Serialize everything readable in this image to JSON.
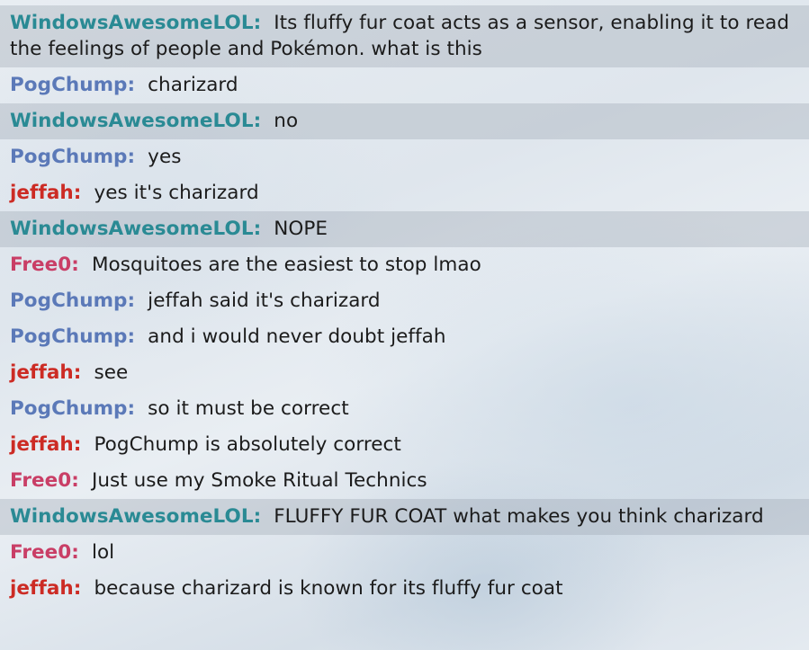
{
  "colors": {
    "WindowsAwesomeLOL": "#2a8a94",
    "PogChump": "#5b79b8",
    "jeffah": "#cc2b24",
    "Free0": "#c93e66"
  },
  "messages": [
    {
      "user": "WindowsAwesomeLOL",
      "text": "Its fluffy fur coat acts as a sensor, enabling it to read the feelings of people and Pokémon. what is this",
      "highlighted": true
    },
    {
      "user": "PogChump",
      "text": "charizard",
      "highlighted": false
    },
    {
      "user": "WindowsAwesomeLOL",
      "text": "no",
      "highlighted": true
    },
    {
      "user": "PogChump",
      "text": "yes",
      "highlighted": false
    },
    {
      "user": "jeffah",
      "text": "yes it's charizard",
      "highlighted": false
    },
    {
      "user": "WindowsAwesomeLOL",
      "text": "NOPE",
      "highlighted": true
    },
    {
      "user": "Free0",
      "text": "Mosquitoes are the easiest to stop lmao",
      "highlighted": false
    },
    {
      "user": "PogChump",
      "text": "jeffah said it's charizard",
      "highlighted": false
    },
    {
      "user": "PogChump",
      "text": "and i would never doubt jeffah",
      "highlighted": false
    },
    {
      "user": "jeffah",
      "text": "see",
      "highlighted": false
    },
    {
      "user": "PogChump",
      "text": "so it must be correct",
      "highlighted": false
    },
    {
      "user": "jeffah",
      "text": "PogChump is absolutely correct",
      "highlighted": false
    },
    {
      "user": "Free0",
      "text": "Just use my Smoke Ritual Technics",
      "highlighted": false
    },
    {
      "user": "WindowsAwesomeLOL",
      "text": "FLUFFY FUR COAT what makes you think charizard",
      "highlighted": true
    },
    {
      "user": "Free0",
      "text": "lol",
      "highlighted": false
    },
    {
      "user": "jeffah",
      "text": "because charizard is known for its fluffy fur coat",
      "highlighted": false
    }
  ]
}
